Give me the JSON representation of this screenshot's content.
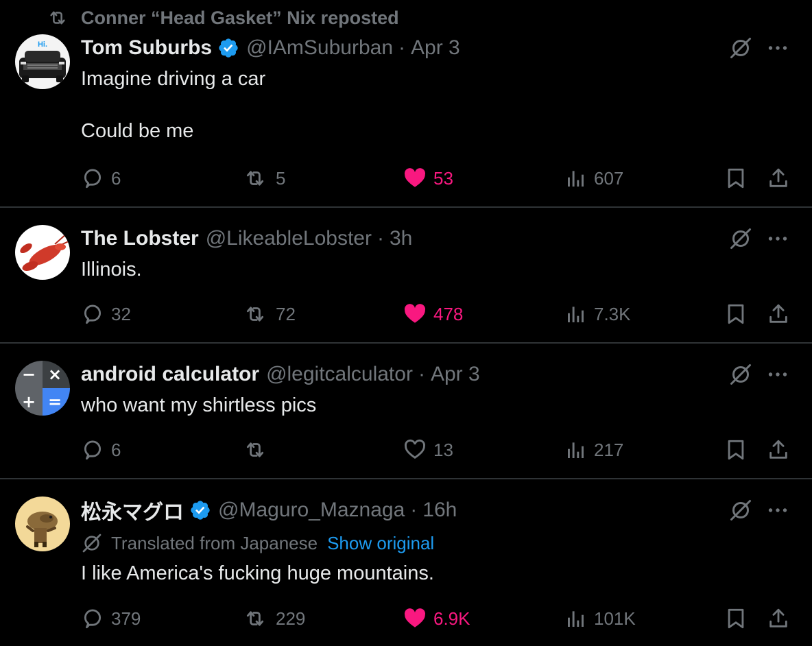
{
  "repost_banner": {
    "text": "Conner “Head Gasket” Nix reposted"
  },
  "colors": {
    "background": "#000000",
    "text": "#e7e9ea",
    "muted": "#71767b",
    "like": "#f91880",
    "link": "#1d9bf0",
    "verified": "#1d9bf0",
    "divider": "#2f3336"
  },
  "tweets": [
    {
      "avatar_label": "Hi.",
      "name": "Tom Suburbs",
      "verified": true,
      "handle": "@IAmSuburban",
      "separator": "·",
      "time": "Apr 3",
      "text": "Imagine driving a car\n\nCould be me",
      "replies": "6",
      "reposts": "5",
      "likes": "53",
      "liked": true,
      "views": "607"
    },
    {
      "name": "The Lobster",
      "verified": false,
      "handle": "@LikeableLobster",
      "separator": "·",
      "time": "3h",
      "text": "Illinois.",
      "replies": "32",
      "reposts": "72",
      "likes": "478",
      "liked": true,
      "views": "7.3K"
    },
    {
      "name": "android calculator",
      "verified": false,
      "handle": "@legitcalculator",
      "separator": "·",
      "time": "Apr 3",
      "text": "who want my shirtless pics",
      "replies": "6",
      "reposts": "",
      "likes": "13",
      "liked": false,
      "views": "217",
      "avatar_symbols": [
        "−",
        "×",
        "+",
        "="
      ]
    },
    {
      "name": "松永マグロ",
      "verified": true,
      "handle": "@Maguro_Maznaga",
      "separator": "·",
      "time": "16h",
      "translated_label": "Translated from Japanese",
      "show_original_label": "Show original",
      "text": "I like America's fucking huge mountains.",
      "replies": "379",
      "reposts": "229",
      "likes": "6.9K",
      "liked": true,
      "views": "101K"
    }
  ],
  "icons": {
    "repost": "repost-icon",
    "reply": "reply-icon",
    "like": "heart-icon",
    "views": "views-icon",
    "bookmark": "bookmark-icon",
    "share": "share-icon",
    "grok": "grok-icon",
    "more": "more-icon",
    "verified": "verified-badge-icon"
  }
}
